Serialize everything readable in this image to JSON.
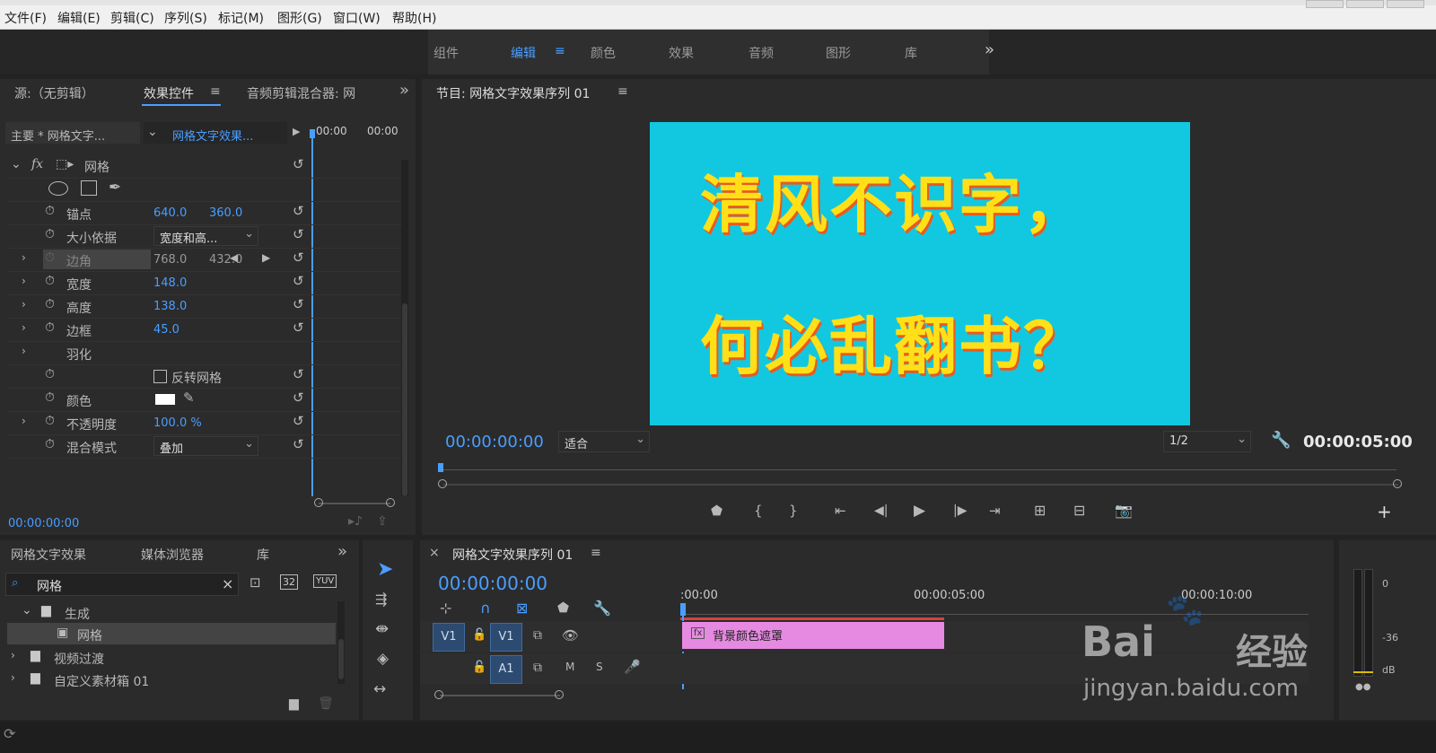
{
  "menu": [
    "文件(F)",
    "编辑(E)",
    "剪辑(C)",
    "序列(S)",
    "标记(M)",
    "图形(G)",
    "窗口(W)",
    "帮助(H)"
  ],
  "workspaces": {
    "tabs": [
      "组件",
      "编辑",
      "颜色",
      "效果",
      "音频",
      "图形",
      "库"
    ],
    "active": "编辑",
    "overflow": "»"
  },
  "source_panel": {
    "tab_source": "源:（无剪辑）",
    "tab_effect_controls": "效果控件",
    "tab_audio_mixer": "音频剪辑混合器: 网",
    "menu_icon": "≡",
    "overflow": "»",
    "clip_master": "主要 * 网格文字...",
    "clip_selected": "网格文字效果...",
    "ruler_start": "00:00",
    "ruler_end": "00:00",
    "effect_name": "网格",
    "fx_label": "fx",
    "properties": [
      {
        "label": "锚点",
        "value1": "640.0",
        "value2": "360.0"
      },
      {
        "label": "大小依据",
        "dropdown": "宽度和高..."
      },
      {
        "label": "边角",
        "value1": "768.0",
        "value2": "432.0"
      },
      {
        "label": "宽度",
        "value1": "148.0"
      },
      {
        "label": "高度",
        "value1": "138.0"
      },
      {
        "label": "边框",
        "value1": "45.0"
      },
      {
        "label": "羽化"
      },
      {
        "label": "",
        "checkbox": "反转网格"
      },
      {
        "label": "颜色"
      },
      {
        "label": "不透明度",
        "value1": "100.0 %"
      },
      {
        "label": "混合模式",
        "dropdown": "叠加"
      }
    ],
    "timecode": "00:00:00:00"
  },
  "program_monitor": {
    "title": "节目: 网格文字效果序列 01",
    "menu_icon": "≡",
    "video_line1": "清风不识字，",
    "video_line2": "何必乱翻书？",
    "bg_color": "#12c8e0",
    "timecode_current": "00:00:00:00",
    "zoom": "适合",
    "resolution": "1/2",
    "timecode_duration": "00:00:05:00",
    "add_button": "+"
  },
  "project_panel": {
    "tab_project": "网格文字效果",
    "tab_media_browser": "媒体浏览器",
    "tab_library": "库",
    "overflow": "»",
    "search_value": "网格",
    "clear": "×",
    "badge_32": "32",
    "badge_yuv": "YUV",
    "tree": [
      {
        "label": "生成",
        "level": 1,
        "expanded": true
      },
      {
        "label": "网格",
        "level": 2,
        "selected": true
      },
      {
        "label": "视频过渡",
        "level": 1
      },
      {
        "label": "自定义素材箱 01",
        "level": 1
      }
    ]
  },
  "timeline": {
    "close": "×",
    "title": "网格文字效果序列 01",
    "menu_icon": "≡",
    "timecode": "00:00:00:00",
    "ruler": [
      ":00:00",
      "00:00:05:00",
      "00:00:10:00"
    ],
    "tracks": [
      {
        "patch": "V1",
        "name": "V1"
      },
      {
        "patch": "",
        "name": "A1",
        "mute": "M",
        "solo": "S"
      }
    ],
    "clip_name": "背景颜色遮罩",
    "clip_color": "#e58ae0"
  },
  "audio_meter": {
    "scale": [
      "0",
      "-36",
      "dB"
    ]
  },
  "watermark": {
    "brand": "Bai",
    "brand2": "经验",
    "url": "jingyan.baidu.com"
  }
}
